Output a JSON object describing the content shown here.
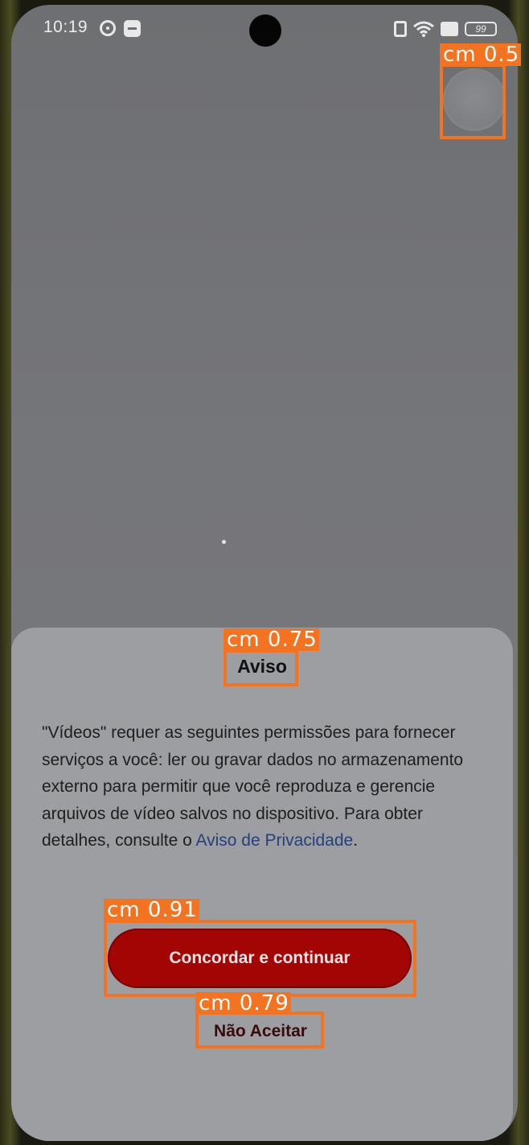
{
  "status_bar": {
    "time": "10:19",
    "battery_level": "99"
  },
  "dialog": {
    "title": "Aviso",
    "body_text": "\"Vídeos\" requer as seguintes permissões para fornecer serviços a você: ler ou gravar dados no armazenamento externo para permitir que você reproduza e gerencie arquivos de vídeo salvos no dispositivo. Para obter detalhes, consulte o ",
    "privacy_link": "Aviso de Privacidade",
    "body_end": ".",
    "agree_button": "Concordar e continuar",
    "decline_button": "Não Aceitar"
  },
  "detections": [
    {
      "label": "cm 0.5"
    },
    {
      "label": "cm 0.75"
    },
    {
      "label": "cm 0.91"
    },
    {
      "label": "cm 0.79"
    }
  ],
  "colors": {
    "accent_red": "#a30505",
    "detection_box": "#f47321",
    "link_blue": "#27407a"
  }
}
